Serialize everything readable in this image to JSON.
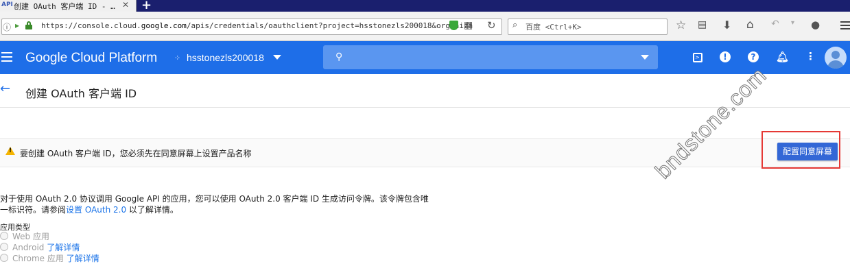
{
  "browser": {
    "tab": {
      "favicon_text": "API",
      "title": "创建 OAuth 客户端 ID - …",
      "close": "✕"
    },
    "new_tab": "+",
    "url": {
      "prefix": "https://console.cloud.",
      "domain": "google.com",
      "rest": "/apis/credentials/oauthclient?project=hsstonezls200018&organiza"
    },
    "search_placeholder": "百度 <Ctrl+K>"
  },
  "header": {
    "brand": "Google Cloud Platform",
    "project": "hsstonezls200018"
  },
  "page": {
    "title": "创建 OAuth 客户端 ID"
  },
  "warning": {
    "text": "要创建 OAuth 客户端 ID，您必须先在同意屏幕上设置产品名称",
    "button": "配置同意屏幕"
  },
  "description": {
    "line1": "对于使用 OAuth 2.0 协议调用 Google API 的应用，您可以使用 OAuth 2.0 客户端 ID 生成访问令牌。该令牌包含唯",
    "line2_prefix": "一标识符。请参阅",
    "line2_link": "设置 OAuth 2.0",
    "line2_suffix": " 以了解详情。"
  },
  "app_type": {
    "label": "应用类型",
    "options": [
      {
        "label": "Web 应用",
        "link": ""
      },
      {
        "label": "Android ",
        "link": "了解详情"
      },
      {
        "label": "Chrome 应用 ",
        "link": "了解详情"
      }
    ]
  },
  "watermark": "bndstone.com",
  "colors": {
    "tab_strip": "#1a1f6e",
    "gcp_blue": "#1e6ee8",
    "button_blue": "#3367d6",
    "warning_yellow": "#f5b400",
    "highlight_red": "#e53935",
    "link_blue": "#1a73e8"
  }
}
